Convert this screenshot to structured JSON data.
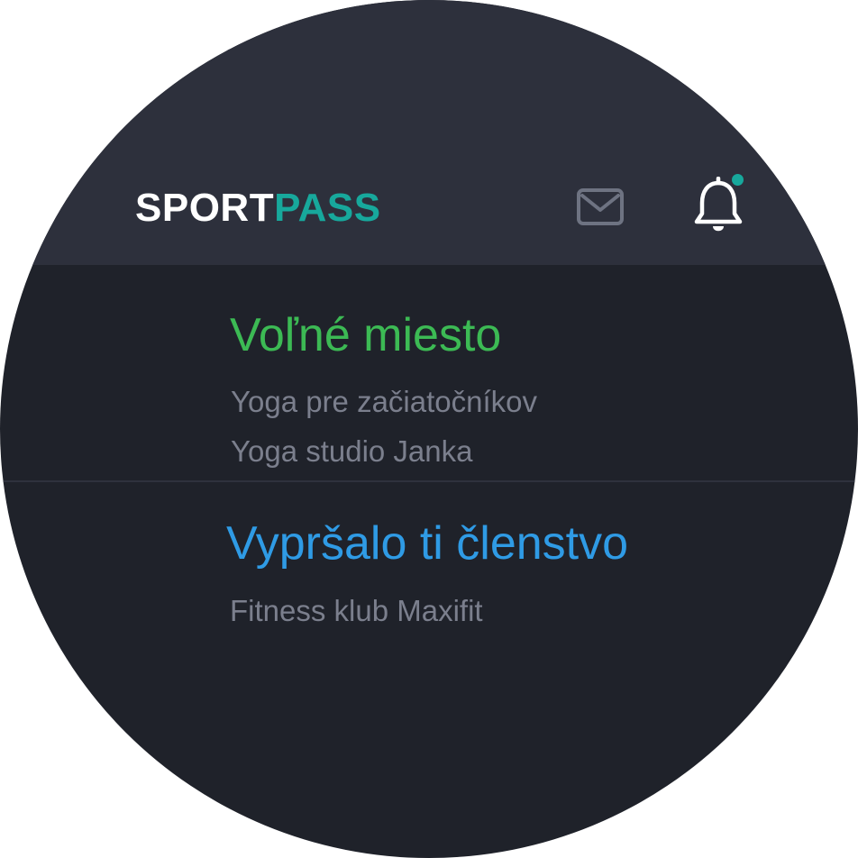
{
  "header": {
    "logo_part1": "SPORT",
    "logo_part2": "PASS",
    "mail_icon": "envelope-icon",
    "bell_icon": "bell-icon",
    "has_unread_notification": true
  },
  "notifications": [
    {
      "title": "Voľné miesto",
      "lines": [
        "Yoga pre začiatočníkov",
        "Yoga studio Janka"
      ],
      "title_color": "#3cba54"
    },
    {
      "title": "Vypršalo ti členstvo",
      "lines": [
        "Fitness klub Maxifit"
      ],
      "title_color": "#2f9be5"
    }
  ],
  "colors": {
    "accent": "#17a89c",
    "background": "#1f222a",
    "header_background": "#2d303c",
    "secondary_text": "#7b7f8d"
  }
}
